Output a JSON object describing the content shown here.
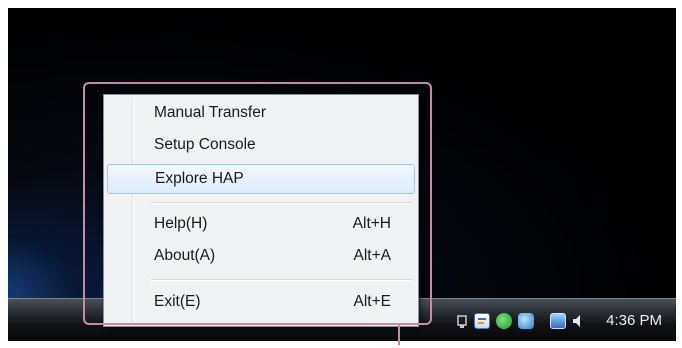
{
  "context_menu": {
    "items": [
      {
        "label": "Manual Transfer",
        "shortcut": ""
      },
      {
        "label": "Setup Console",
        "shortcut": ""
      },
      {
        "label": "Explore HAP",
        "shortcut": "",
        "highlighted": true
      },
      {
        "label": "Help(H)",
        "shortcut": "Alt+H"
      },
      {
        "label": "About(A)",
        "shortcut": "Alt+A"
      },
      {
        "label": "Exit(E)",
        "shortcut": "Alt+E"
      }
    ]
  },
  "taskbar": {
    "clock": "4:36 PM",
    "tray_icons": [
      "network-icon",
      "notes-icon",
      "sync-icon",
      "app-icon",
      "monitor-icon",
      "speaker-icon"
    ]
  },
  "colors": {
    "highlight_box": "#c68ca5",
    "menu_background": "#f1f2f4",
    "menu_highlight": "#dcebfa",
    "desktop": "#000000"
  }
}
